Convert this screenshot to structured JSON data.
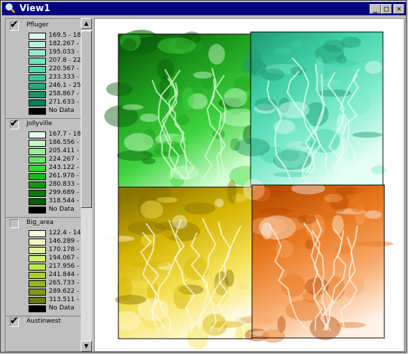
{
  "window": {
    "title": "View1",
    "buttons": {
      "minimize": "_",
      "maximize": "□",
      "close": "✕"
    }
  },
  "legend": {
    "layers": [
      {
        "name": "Pfluger",
        "checked": true,
        "classes": [
          {
            "label": "169.5 - 18",
            "color": "#d9f8ec"
          },
          {
            "label": "182.267 -",
            "color": "#b7f1dd"
          },
          {
            "label": "195.033 -",
            "color": "#95ecd0"
          },
          {
            "label": "207.8 - 22",
            "color": "#6fe3bf"
          },
          {
            "label": "220.567 -",
            "color": "#4fdcb0"
          },
          {
            "label": "233.333 -",
            "color": "#35c796"
          },
          {
            "label": "246.1 - 25",
            "color": "#25ad7e"
          },
          {
            "label": "258.867 -",
            "color": "#189465"
          },
          {
            "label": "271.633 -",
            "color": "#0c7c52"
          },
          {
            "label": "No Data",
            "color": "#000000"
          }
        ]
      },
      {
        "name": "Jollyville",
        "checked": true,
        "classes": [
          {
            "label": "167.7 - 18",
            "color": "#e9fbe9"
          },
          {
            "label": "186.556 -",
            "color": "#c6f6c6"
          },
          {
            "label": "205.411 -",
            "color": "#9af09a"
          },
          {
            "label": "224.267 -",
            "color": "#64e864"
          },
          {
            "label": "243.122 -",
            "color": "#2be02b"
          },
          {
            "label": "261.978 -",
            "color": "#12be12"
          },
          {
            "label": "280.833 -",
            "color": "#0a9c0a"
          },
          {
            "label": "299.689 -",
            "color": "#067c06"
          },
          {
            "label": "318.544 -",
            "color": "#035e03"
          },
          {
            "label": "No Data",
            "color": "#000000"
          }
        ]
      },
      {
        "name": "Big_area",
        "checked": false,
        "classes": [
          {
            "label": "122.4 - 14",
            "color": "#f7fde0"
          },
          {
            "label": "146.289 -",
            "color": "#eefac0"
          },
          {
            "label": "170.178 -",
            "color": "#e1f69c"
          },
          {
            "label": "194.067 -",
            "color": "#d0f070"
          },
          {
            "label": "217.956 -",
            "color": "#bde64a"
          },
          {
            "label": "241.844 -",
            "color": "#a8d02e"
          },
          {
            "label": "265.733 -",
            "color": "#93b620"
          },
          {
            "label": "289.622 -",
            "color": "#7c9a14"
          },
          {
            "label": "313.511 -",
            "color": "#647d0c"
          },
          {
            "label": "No Data",
            "color": "#000000"
          }
        ]
      },
      {
        "name": "Austinwest",
        "checked": true,
        "classes": []
      }
    ]
  },
  "scrollbar": {
    "up_arrow": "▲",
    "down_arrow": "▼"
  },
  "map": {
    "background": "#ffffff",
    "tiles": [
      {
        "name": "map-tile-jollyville",
        "colors": [
          "#0b5e0b",
          "#1ea01e",
          "#3fd43f",
          "#d8ffd8"
        ]
      },
      {
        "name": "map-tile-pfluger",
        "colors": [
          "#1e9a72",
          "#3fd0a6",
          "#7eebcc",
          "#e6fff6"
        ]
      },
      {
        "name": "map-tile-yellow",
        "colors": [
          "#8a7400",
          "#d4b400",
          "#f6e256",
          "#fffbe0"
        ]
      },
      {
        "name": "map-tile-orange",
        "colors": [
          "#b54a00",
          "#e8761c",
          "#f7a868",
          "#fff2e6"
        ]
      }
    ]
  }
}
